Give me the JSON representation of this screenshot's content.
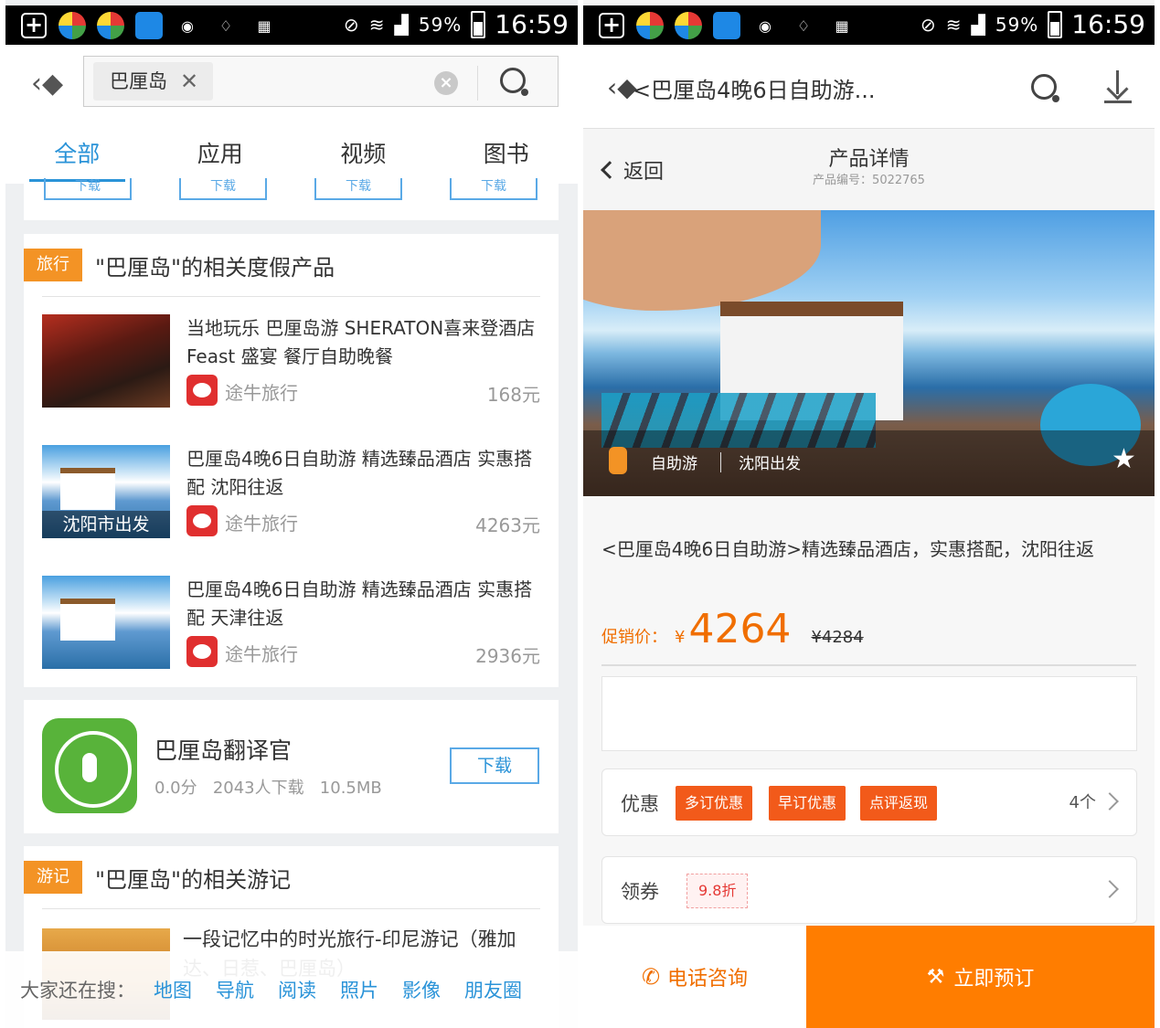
{
  "status_bar": {
    "battery": "59%",
    "time": "16:59"
  },
  "left": {
    "search": {
      "chip": "巴厘岛"
    },
    "tabs": [
      "全部",
      "应用",
      "视频",
      "图书"
    ],
    "strip_buttons": [
      "下载",
      "下载",
      "下载",
      "下载"
    ],
    "travel": {
      "tag": "旅行",
      "title": "\"巴厘岛\"的相关度假产品",
      "items": [
        {
          "title": "当地玩乐 巴厘岛游 SHERATON喜来登酒店Feast 盛宴 餐厅自助晚餐",
          "source": "途牛旅行",
          "price": "168元",
          "thumb_label": ""
        },
        {
          "title": "巴厘岛4晚6日自助游 精选臻品酒店 实惠搭配 沈阳往返",
          "source": "途牛旅行",
          "price": "4263元",
          "thumb_label": "沈阳市出发"
        },
        {
          "title": "巴厘岛4晚6日自助游 精选臻品酒店 实惠搭配 天津往返",
          "source": "途牛旅行",
          "price": "2936元",
          "thumb_label": ""
        }
      ]
    },
    "app": {
      "name": "巴厘岛翻译官",
      "score": "0.0分",
      "downloads": "2043人下载",
      "size": "10.5MB",
      "button": "下载"
    },
    "notes": {
      "tag": "游记",
      "title": "\"巴厘岛\"的相关游记",
      "first_title": "一段记忆中的时光旅行-印尼游记（雅加达、日惹、巴厘岛）"
    },
    "also_search": {
      "label": "大家还在搜：",
      "links": [
        "地图",
        "导航",
        "阅读",
        "照片",
        "影像",
        "朋友圈"
      ]
    }
  },
  "right": {
    "header": {
      "title": "<巴厘岛4晚6日自助游..."
    },
    "subheader": {
      "back": "返回",
      "title": "产品详情",
      "code": "产品编号：5022765"
    },
    "hero": {
      "tag1": "自助游",
      "tag2": "沈阳出发"
    },
    "desc": "<巴厘岛4晚6日自助游>精选臻品酒店，实惠搭配，沈阳往返",
    "price": {
      "label": "促销价：",
      "currency": "¥",
      "value": "4264",
      "original": "¥4284"
    },
    "offers": {
      "label": "优惠",
      "badges": [
        "多订优惠",
        "早订优惠",
        "点评返现"
      ],
      "count": "4个"
    },
    "coupon": {
      "label": "领券",
      "discount": "9.8折"
    },
    "footer": {
      "call": "电话咨询",
      "book": "立即预订"
    }
  }
}
